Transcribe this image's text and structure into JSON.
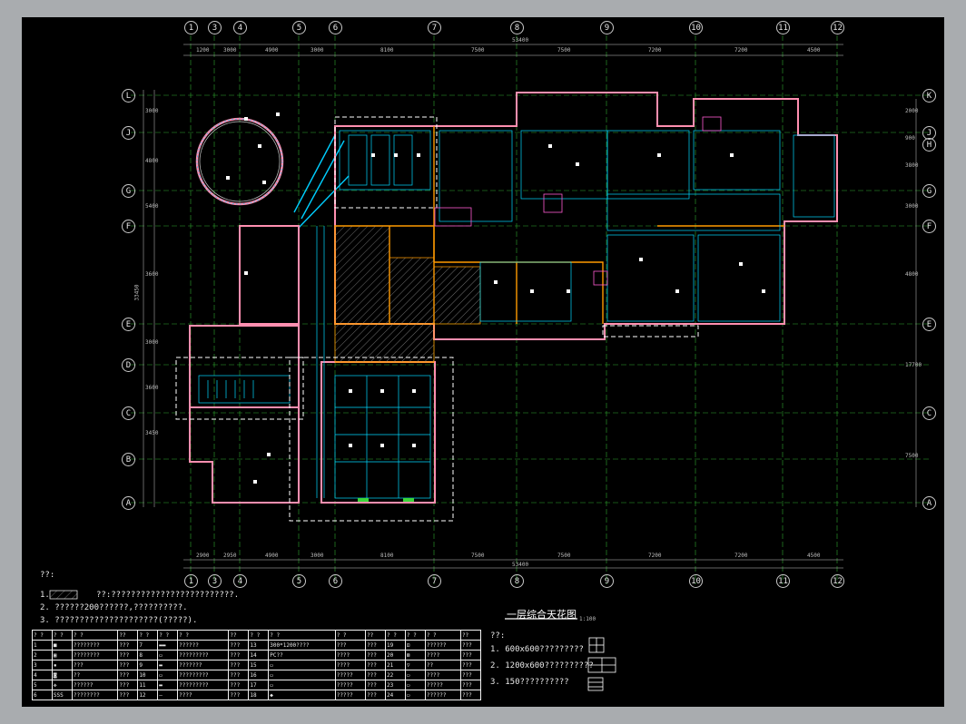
{
  "window": {
    "background": "#a9acaf",
    "sheet_background": "#000000"
  },
  "grid": {
    "columns_top": [
      "1",
      "3",
      "4",
      "5",
      "6",
      "7",
      "8",
      "9",
      "10",
      "11",
      "12"
    ],
    "columns_bottom": [
      "1",
      "3",
      "4",
      "5",
      "6",
      "7",
      "8",
      "9",
      "10",
      "11",
      "12"
    ],
    "rows_left": [
      "L",
      "J",
      "G",
      "F",
      "E",
      "D",
      "C",
      "B",
      "A"
    ],
    "rows_right": [
      "K",
      "J",
      "H",
      "G",
      "F",
      "E",
      "C",
      "A"
    ],
    "dims_top": [
      "1200",
      "3000",
      "4900",
      "3000",
      "8100",
      "7500",
      "7500",
      "7200",
      "7200",
      "4500"
    ],
    "dims_top_total": "53400",
    "dims_bottom": [
      "2900",
      "2950",
      "4900",
      "3000",
      "8100",
      "7500",
      "7500",
      "7200",
      "7200",
      "4500"
    ],
    "dims_bottom_total": "53400",
    "dims_left": [
      "3000",
      "4800",
      "5400",
      "3600",
      "3000",
      "3600",
      "3450"
    ],
    "dims_left_total": "33450",
    "dims_right": [
      "2000",
      "900",
      "3800",
      "3000",
      "4800",
      "17700",
      "7500"
    ]
  },
  "notes": {
    "header": "??:",
    "line1_prefix": "1.",
    "line1": "??:?????????????????????????.",
    "line2": "2. ??????200??????,??????????.",
    "line3": "3. ?????????????????????(?????)."
  },
  "drawing_title": {
    "text": "一层综合天花图",
    "scale": "1:100"
  },
  "ceiling_notes": {
    "header": "??:",
    "items": [
      "1. 600x600?????????",
      "2. 1200x600??????????",
      "3. 150??????????"
    ]
  },
  "legend": {
    "headers": [
      "? ?",
      "? ?",
      "? ?",
      "??",
      "? ?",
      "? ?",
      "? ?",
      "??",
      "? ?",
      "? ?",
      "? ?",
      "??",
      "? ?",
      "? ?",
      "? ?",
      "??"
    ],
    "rows": [
      [
        "1",
        "■",
        "????????",
        "???",
        "7",
        "▬▬",
        "??????",
        "???",
        "13",
        "300*1200????",
        "???",
        "???",
        "19",
        "⊡",
        "??????",
        "???"
      ],
      [
        "2",
        "▣",
        "????????",
        "???",
        "8",
        "▭",
        "?????????",
        "???",
        "14",
        "PC??",
        "????",
        "???",
        "20",
        "⊠",
        "????",
        "???"
      ],
      [
        "3",
        "▪",
        "???",
        "???",
        "9",
        "▬",
        "???????",
        "???",
        "15",
        "▭",
        "????",
        "???",
        "21",
        "▽",
        "??",
        "???"
      ],
      [
        "4",
        "◙",
        "??",
        "???",
        "10",
        "▭",
        "?????????",
        "???",
        "16",
        "▭",
        "?????",
        "???",
        "22",
        "▭",
        "????",
        "???"
      ],
      [
        "5",
        "✥",
        "??????",
        "???",
        "11",
        "▬",
        "?????????",
        "???",
        "17",
        "▭",
        "?????",
        "???",
        "23",
        "▭",
        "?????",
        "???"
      ],
      [
        "6",
        "SSS",
        "????????",
        "???",
        "12",
        "—",
        "????",
        "???",
        "18",
        "◆",
        "?????",
        "???",
        "24",
        "▭",
        "??????",
        "???"
      ]
    ]
  }
}
